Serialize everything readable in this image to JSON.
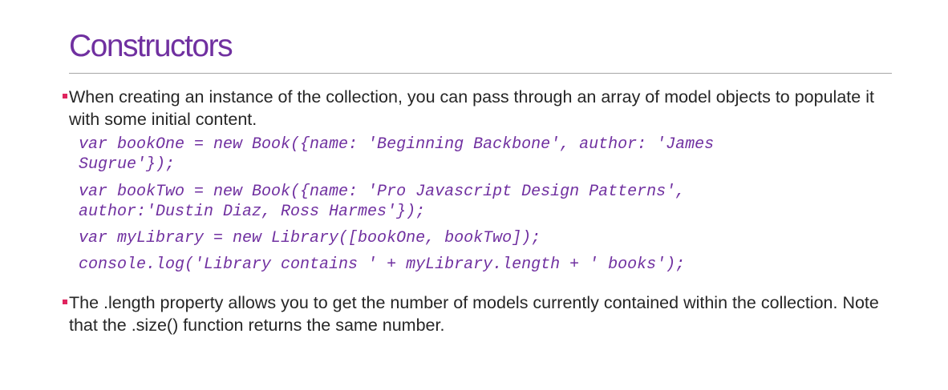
{
  "slide": {
    "title": "Constructors",
    "bullets": [
      "When creating an instance of the collection, you can pass through an array of model objects to populate it with some initial content.",
      "The .length property allows you to get the number of models currently contained within the collection. Note that the .size() function returns the same number."
    ],
    "code": [
      "var bookOne = new Book({name: 'Beginning Backbone', author: 'James\nSugrue'});",
      "var bookTwo = new Book({name: 'Pro Javascript Design Patterns',\nauthor:'Dustin Diaz, Ross Harmes'});",
      "var myLibrary = new Library([bookOne, bookTwo]);",
      "console.log('Library contains ' + myLibrary.length + ' books');"
    ],
    "colors": {
      "title": "#7030a0",
      "code": "#7030a0",
      "bullet_marker": "#e0245e",
      "rule": "#a6a6a6",
      "text": "#262626"
    }
  }
}
